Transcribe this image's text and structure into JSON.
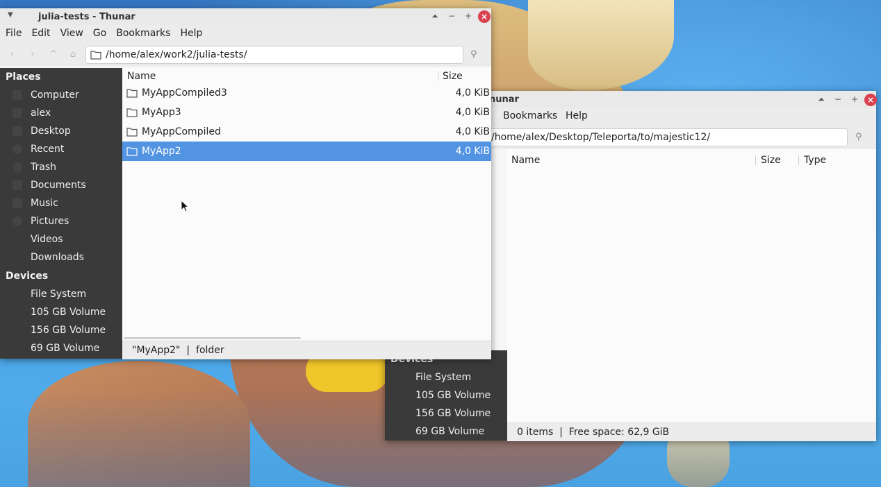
{
  "win1": {
    "title": "julia-tests - Thunar",
    "menu": [
      "File",
      "Edit",
      "View",
      "Go",
      "Bookmarks",
      "Help"
    ],
    "path": "/home/alex/work2/julia-tests/",
    "places_header": "Places",
    "places": [
      "Computer",
      "alex",
      "Desktop",
      "Recent",
      "Trash",
      "Documents",
      "Music",
      "Pictures",
      "Videos",
      "Downloads"
    ],
    "devices_header": "Devices",
    "devices": [
      "File System",
      "105 GB Volume",
      "156 GB Volume",
      "69 GB Volume"
    ],
    "columns": {
      "name": "Name",
      "size": "Size"
    },
    "files": [
      {
        "name": "MyAppCompiled3",
        "size": "4,0 KiB",
        "selected": false
      },
      {
        "name": "MyApp3",
        "size": "4,0 KiB",
        "selected": false
      },
      {
        "name": "MyAppCompiled",
        "size": "4,0 KiB",
        "selected": false
      },
      {
        "name": "MyApp2",
        "size": "4,0 KiB",
        "selected": true
      }
    ],
    "status": "\"MyApp2\"  |  folder"
  },
  "win2": {
    "title_fragment": "nunar",
    "menu": [
      "Bookmarks",
      "Help"
    ],
    "path": "/home/alex/Desktop/Teleporta/to/majestic12/",
    "devices_header": "Devices",
    "devices": [
      "File System",
      "105 GB Volume",
      "156 GB Volume",
      "69 GB Volume"
    ],
    "columns": {
      "name": "Name",
      "size": "Size",
      "type": "Type"
    },
    "status": "0 items  |  Free space: 62,9 GiB"
  },
  "colors": {
    "selection": "#5294e2",
    "close": "#d9414e",
    "sidebar": "#3a3a3a"
  }
}
